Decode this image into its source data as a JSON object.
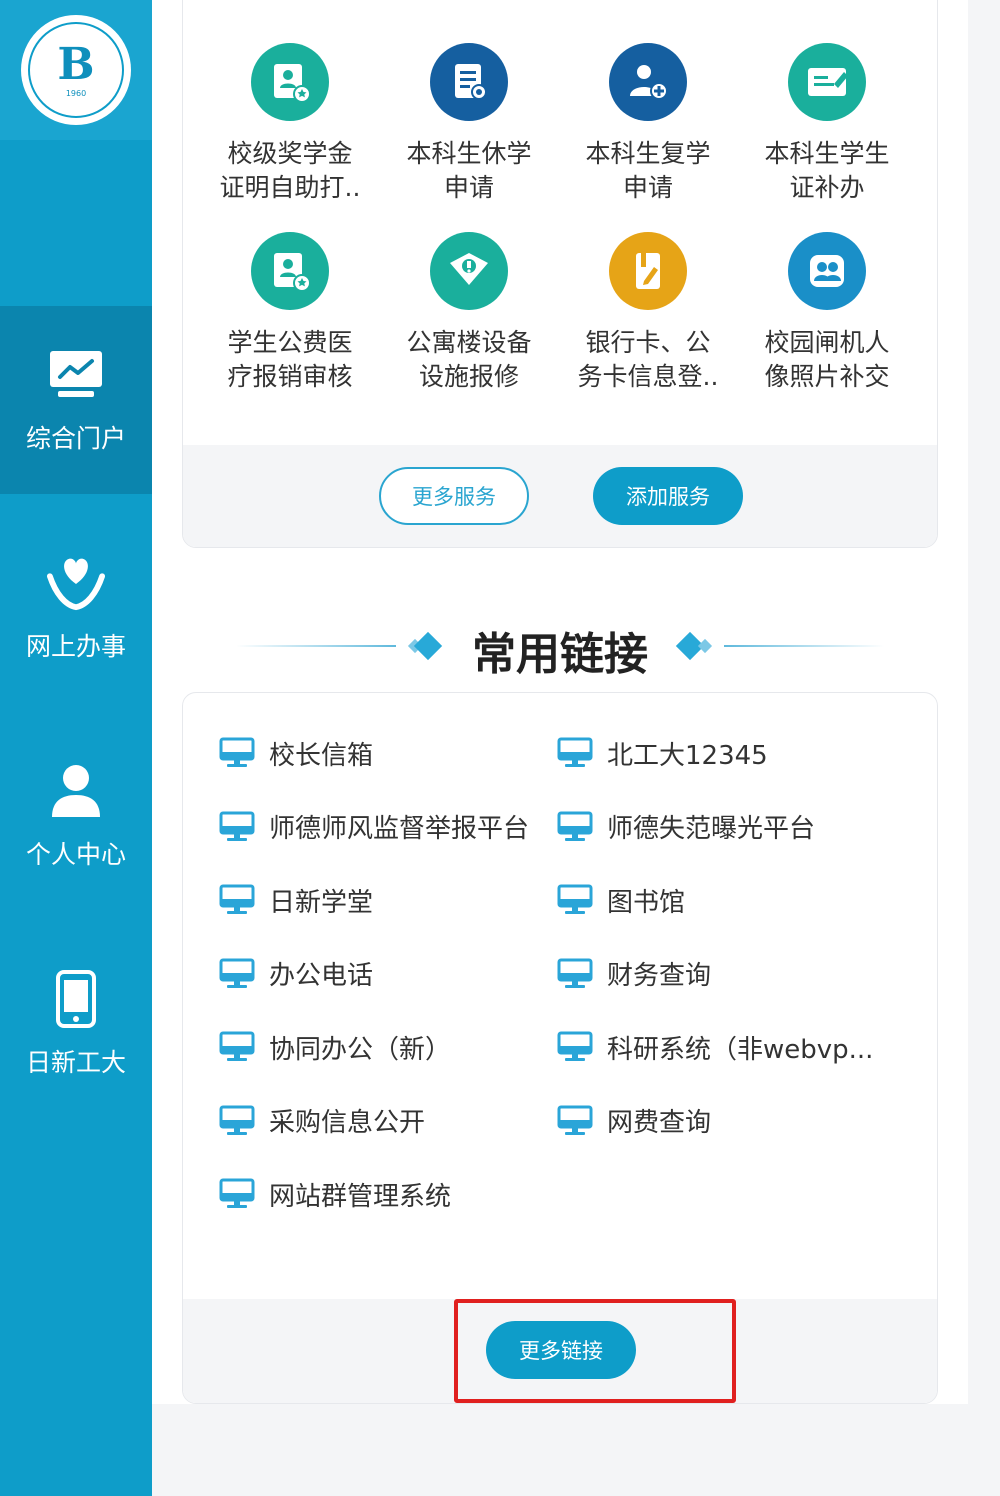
{
  "sidebar": {
    "logo_mark": "B",
    "logo_sub": "1960",
    "items": [
      {
        "label": "综合门户",
        "icon": "monitor-chart-icon",
        "active": true
      },
      {
        "label": "网上办事",
        "icon": "heart-hand-icon",
        "active": false
      },
      {
        "label": "个人中心",
        "icon": "person-icon",
        "active": false
      },
      {
        "label": "日新工大",
        "icon": "mobile-phone-icon",
        "active": false
      }
    ]
  },
  "services": {
    "items": [
      {
        "label_line1": "校级奖学金",
        "label_line2": "证明自助打..",
        "icon": "certificate-icon",
        "color": "#1aaf9c"
      },
      {
        "label_line1": "本科生休学",
        "label_line2": "申请",
        "icon": "document-award-icon",
        "color": "#155fa0"
      },
      {
        "label_line1": "本科生复学",
        "label_line2": "申请",
        "icon": "person-add-icon",
        "color": "#155fa0"
      },
      {
        "label_line1": "本科生学生",
        "label_line2": "证补办",
        "icon": "id-card-edit-icon",
        "color": "#1aaf9c"
      },
      {
        "label_line1": "学生公费医",
        "label_line2": "疗报销审核",
        "icon": "certificate-icon",
        "color": "#1aaf9c"
      },
      {
        "label_line1": "公寓楼设备",
        "label_line2": "设施报修",
        "icon": "shield-wrench-icon",
        "color": "#1aaf9c"
      },
      {
        "label_line1": "银行卡、公",
        "label_line2": "务卡信息登..",
        "icon": "card-edit-icon",
        "color": "#e6a417"
      },
      {
        "label_line1": "校园闸机人",
        "label_line2": "像照片补交",
        "icon": "group-photo-icon",
        "color": "#1a8fc8"
      }
    ],
    "more_label": "更多服务",
    "add_label": "添加服务"
  },
  "links_section": {
    "title": "常用链接",
    "items": [
      {
        "label": "校长信箱"
      },
      {
        "label": "北工大12345"
      },
      {
        "label": "师德师风监督举报平台"
      },
      {
        "label": "师德失范曝光平台"
      },
      {
        "label": "日新学堂"
      },
      {
        "label": "图书馆"
      },
      {
        "label": "办公电话"
      },
      {
        "label": "财务查询"
      },
      {
        "label": "协同办公（新）"
      },
      {
        "label": "科研系统（非webvp..."
      },
      {
        "label": "采购信息公开"
      },
      {
        "label": "网费查询"
      },
      {
        "label": "网站群管理系统"
      }
    ],
    "more_label": "更多链接"
  },
  "colors": {
    "sidebar": "#0e9dc9",
    "sidebar_active": "#0b85ae",
    "accent": "#0e9dc9",
    "highlight": "#e0201f"
  }
}
